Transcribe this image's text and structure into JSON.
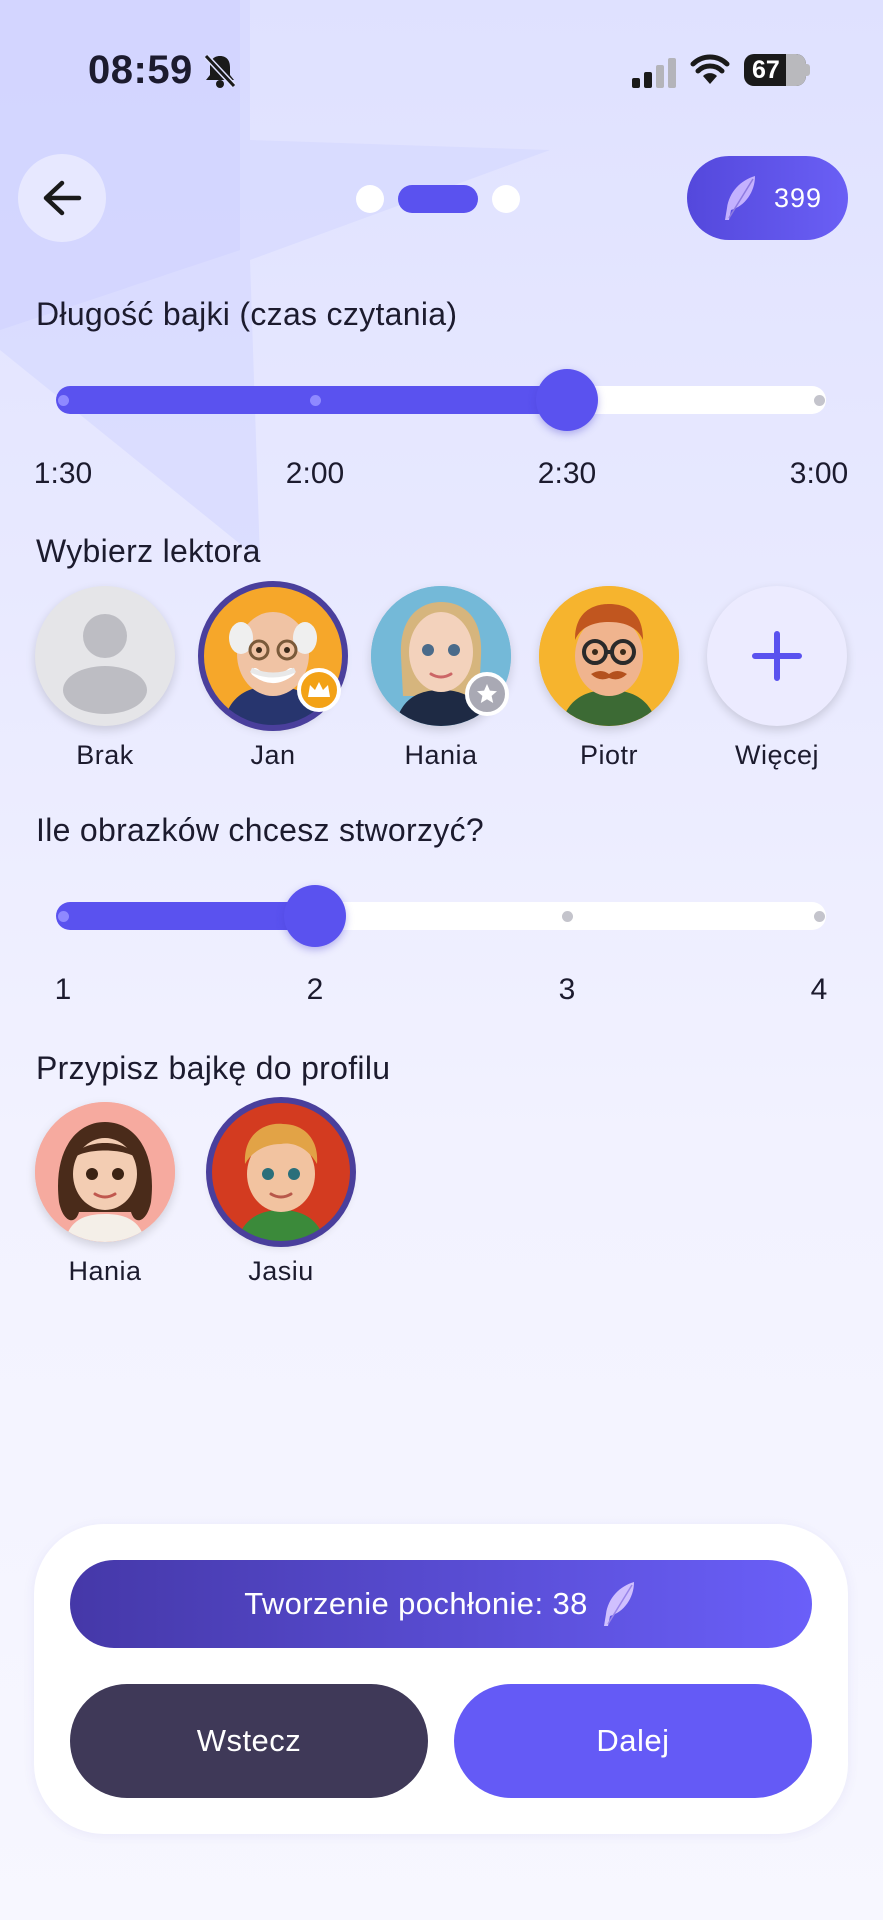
{
  "status_bar": {
    "time": "08:59",
    "battery": "67",
    "battery_level": 0.67
  },
  "header": {
    "credits": "399",
    "steps": {
      "total": 3,
      "current": 2
    }
  },
  "length": {
    "title": "Długość bajki (czas czytania)",
    "options": [
      "1:30",
      "2:00",
      "2:30",
      "3:00"
    ],
    "selected_index": 2
  },
  "narrator": {
    "title": "Wybierz lektora",
    "items": [
      {
        "label": "Brak",
        "kind": "none"
      },
      {
        "label": "Jan",
        "kind": "jan",
        "badge": "crown-icon",
        "selected": true
      },
      {
        "label": "Hania",
        "kind": "hania",
        "badge": "star-icon"
      },
      {
        "label": "Piotr",
        "kind": "piotr"
      },
      {
        "label": "Więcej",
        "kind": "more"
      }
    ]
  },
  "images": {
    "title": "Ile obrazków chcesz stworzyć?",
    "options": [
      "1",
      "2",
      "3",
      "4"
    ],
    "selected_index": 1
  },
  "profile": {
    "title": "Przypisz bajkę do profilu",
    "items": [
      {
        "label": "Hania",
        "selected": false
      },
      {
        "label": "Jasiu",
        "selected": true
      }
    ]
  },
  "footer": {
    "cost_label": "Tworzenie pochłonie: 38",
    "back_label": "Wstecz",
    "next_label": "Dalej"
  },
  "colors": {
    "accent": "#5a52ef",
    "dark_button": "#3f3958",
    "badge_gold": "#f3a216",
    "badge_gray": "#a9a9b4"
  }
}
